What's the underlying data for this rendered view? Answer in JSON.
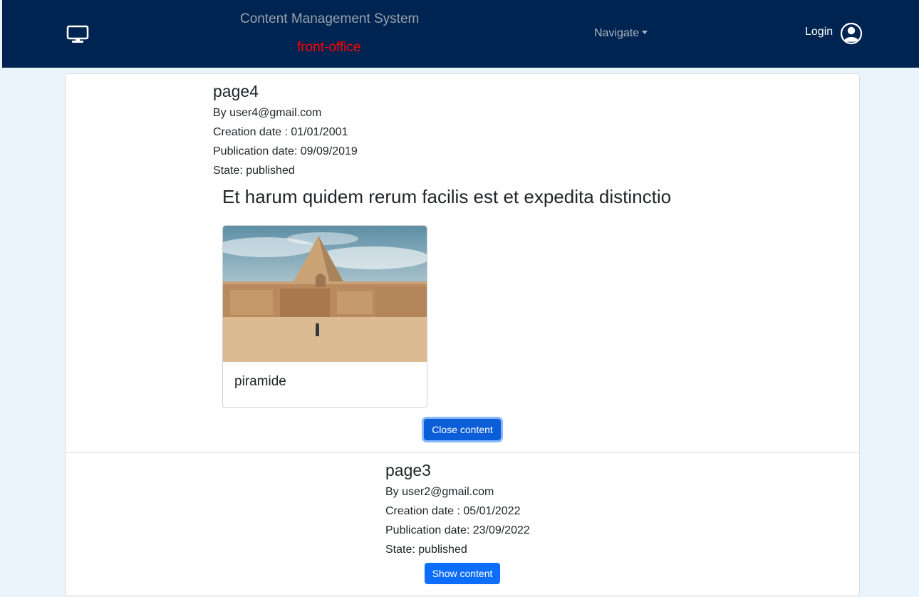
{
  "header": {
    "title": "Content Management System",
    "subtitle": "front-office",
    "nav_label": "Navigate",
    "login_label": "Login",
    "colors": {
      "background": "#002451",
      "subtitle": "#ff0000"
    },
    "icons": {
      "brand": "monitor-icon",
      "user": "user-circle-icon",
      "caret": "caret-down-icon"
    }
  },
  "pages": [
    {
      "title": "page4",
      "author": "By user4@gmail.com",
      "creation": "Creation date : 01/01/2001",
      "publication": "Publication date: 09/09/2019",
      "state": "State: published",
      "content_heading": "Et harum quidem rerum facilis est et expedita distinctio",
      "media_caption": "piramide",
      "button_label": "Close content"
    },
    {
      "title": "page3",
      "author": "By user2@gmail.com",
      "creation": "Creation date : 05/01/2022",
      "publication": "Publication date: 23/09/2022",
      "state": "State: published",
      "button_label": "Show content"
    }
  ],
  "colors": {
    "page_background": "#eaf4fd",
    "primary": "#0d6efd"
  }
}
